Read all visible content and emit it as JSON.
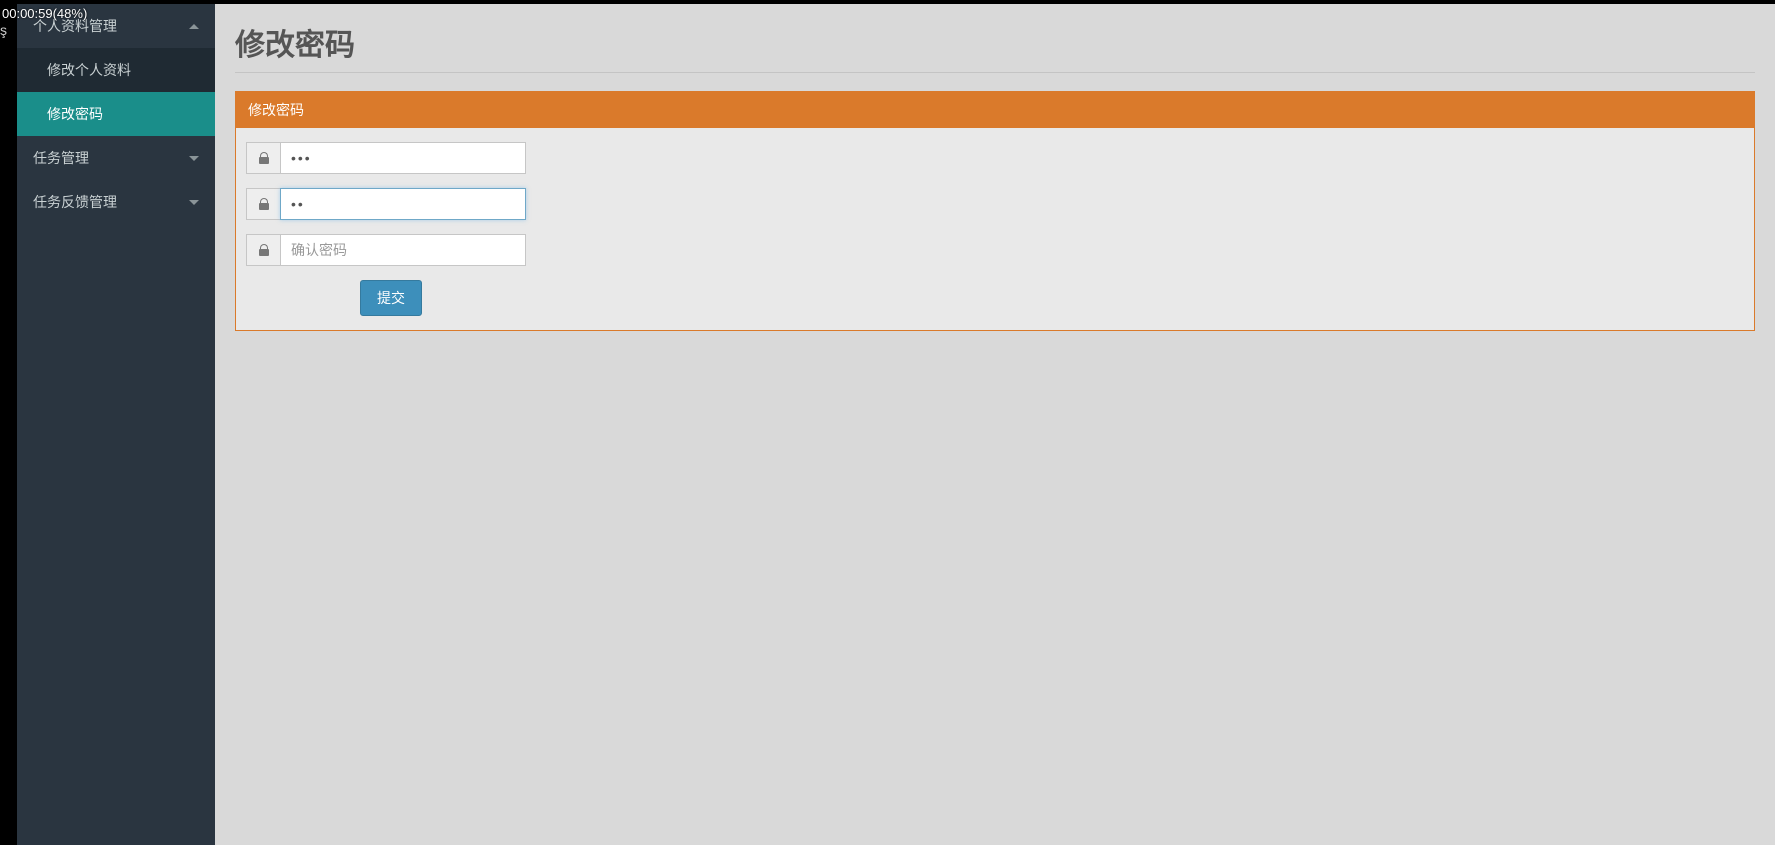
{
  "overlay": {
    "timestamp": "00:00:59(48%)",
    "edge_char": "ş"
  },
  "sidebar": {
    "groups": [
      {
        "label": "个人资料管理",
        "expanded": true,
        "items": [
          {
            "label": "修改个人资料",
            "active": false
          },
          {
            "label": "修改密码",
            "active": true
          }
        ]
      },
      {
        "label": "任务管理",
        "expanded": false
      },
      {
        "label": "任务反馈管理",
        "expanded": false
      }
    ]
  },
  "page": {
    "title": "修改密码",
    "panel_title": "修改密码",
    "form": {
      "old_password": {
        "value": "•••",
        "placeholder": ""
      },
      "new_password": {
        "value": "••",
        "placeholder": ""
      },
      "confirm_password": {
        "value": "",
        "placeholder": "确认密码"
      },
      "submit_label": "提交"
    }
  }
}
